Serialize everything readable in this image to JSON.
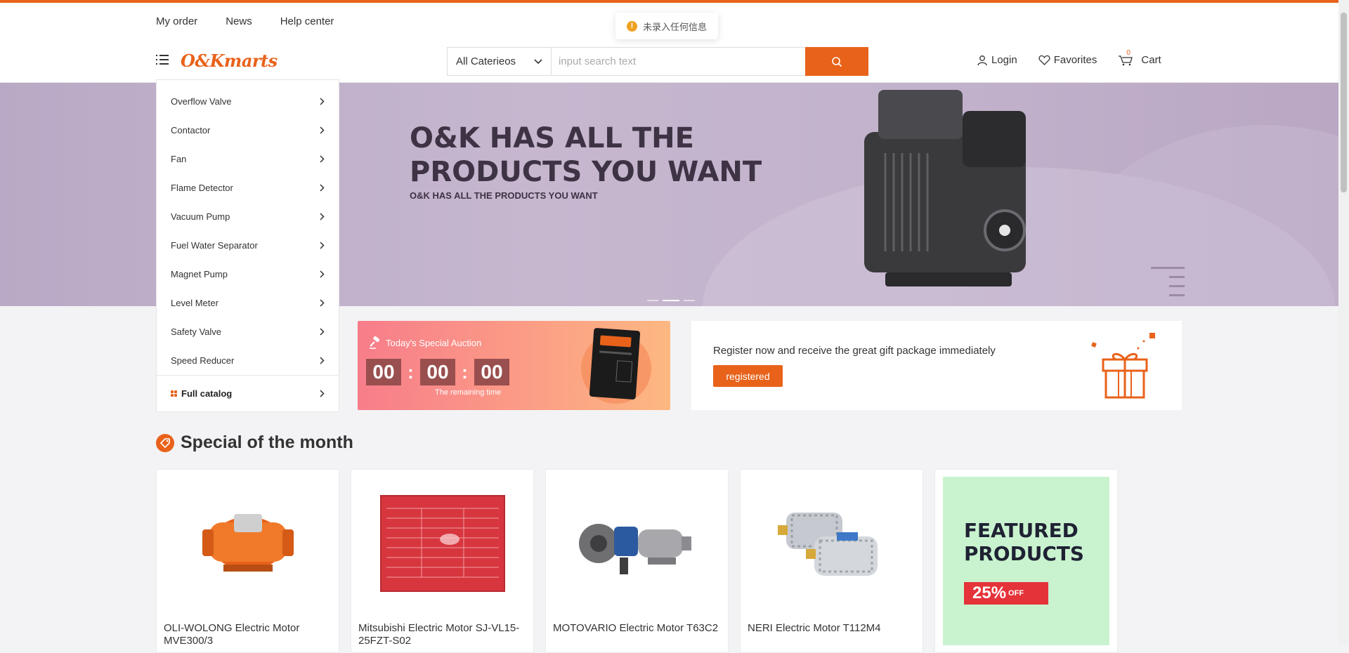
{
  "header": {
    "top_links": [
      "My order",
      "News",
      "Help center"
    ],
    "toast": "未录入任何信息",
    "logo": "O&Kmarts",
    "search": {
      "category": "All Caterieos",
      "placeholder": "input search text"
    },
    "user_links": {
      "login": "Login",
      "favorites": "Favorites",
      "cart": "Cart",
      "cart_count": "0"
    }
  },
  "sidebar": {
    "items": [
      "Overflow Valve",
      "Contactor",
      "Fan",
      "Flame Detector",
      "Vacuum Pump",
      "Fuel Water Separator",
      "Magnet Pump",
      "Level Meter",
      "Safety Valve",
      "Speed Reducer"
    ],
    "full_catalog": "Full catalog"
  },
  "banner": {
    "title_line1": "O&K HAS ALL THE",
    "title_line2": "PRODUCTS YOU WANT",
    "subtitle": "O&K HAS ALL THE PRODUCTS YOU WANT",
    "active_slide": 2
  },
  "auction": {
    "title": "Today's Special Auction",
    "hours": "00",
    "minutes": "00",
    "seconds": "00",
    "remaining_label": "The remaining time"
  },
  "register": {
    "text": "Register now and receive the great gift package immediately",
    "button": "registered"
  },
  "special": {
    "title": "Special of the month",
    "products": [
      {
        "name": "OLI-WOLONG Electric Motor MVE300/3"
      },
      {
        "name": "Mitsubishi Electric Motor SJ-VL15-25FZT-S02"
      },
      {
        "name": "MOTOVARIO Electric Motor T63C2"
      },
      {
        "name": "NERI Electric Motor T112M4"
      }
    ],
    "featured": {
      "line1": "FEATURED",
      "line2": "PRODUCTS",
      "discount": "25%",
      "off": "OFF"
    }
  },
  "colors": {
    "accent": "#e8621a",
    "banner_bg": "#c6b7cf",
    "featured_bg": "#c9f3cf",
    "sale_red": "#e5333a"
  }
}
